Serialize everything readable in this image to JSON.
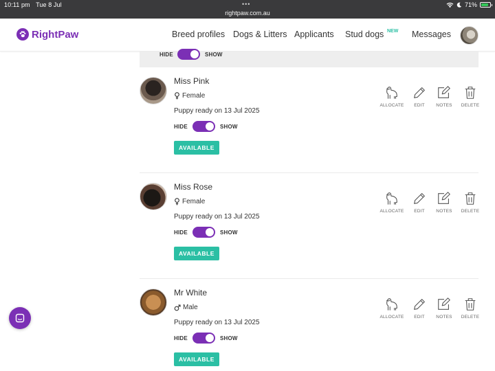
{
  "status": {
    "time": "10:11 pm",
    "date": "Tue 8 Jul",
    "url": "rightpaw.com.au",
    "battery": "71%",
    "battery_level": 0.71,
    "dots": "•••"
  },
  "brand": {
    "name": "RightPaw",
    "color": "#7b2fb5",
    "accent": "#2bbfa4"
  },
  "nav": {
    "breed": "Breed profiles",
    "dogs": "Dogs & Litters",
    "applicants": "Applicants",
    "stud": "Stud dogs",
    "stud_badge": "NEW",
    "messages": "Messages"
  },
  "filter": {
    "hide": "HIDE",
    "show": "SHOW"
  },
  "actions": {
    "allocate": "ALLOCATE",
    "edit": "EDIT",
    "notes": "NOTES",
    "delete": "DELETE"
  },
  "puppies": [
    {
      "name": "Miss Pink",
      "sex": "Female",
      "ready": "Puppy ready on 13 Jul 2025",
      "hide": "HIDE",
      "show": "SHOW",
      "status": "AVAILABLE"
    },
    {
      "name": "Miss Rose",
      "sex": "Female",
      "ready": "Puppy ready on 13 Jul 2025",
      "hide": "HIDE",
      "show": "SHOW",
      "status": "AVAILABLE"
    },
    {
      "name": "Mr White",
      "sex": "Male",
      "ready": "Puppy ready on 13 Jul 2025",
      "hide": "HIDE",
      "show": "SHOW",
      "status": "AVAILABLE"
    }
  ]
}
